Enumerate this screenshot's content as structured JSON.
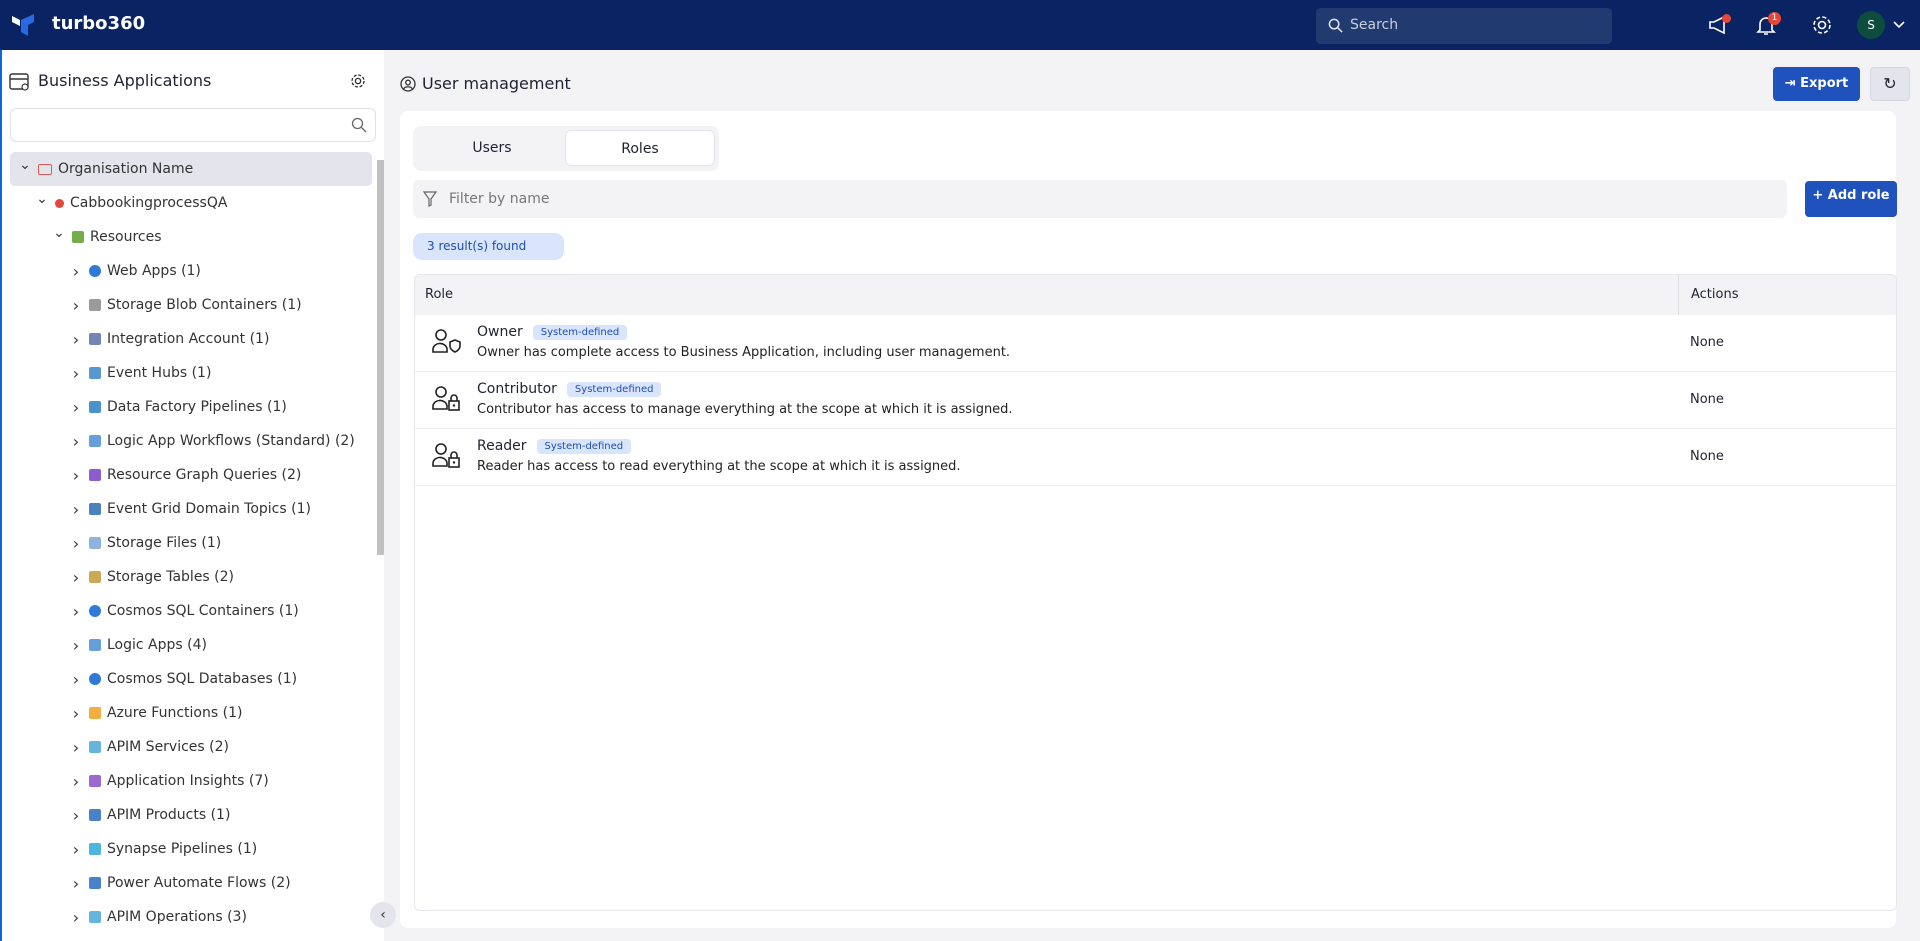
{
  "header": {
    "brand": "turbo360",
    "search_placeholder": "Search",
    "notification_count": "1",
    "avatar_initial": "S"
  },
  "sidebar": {
    "title": "Business Applications",
    "search_placeholder": "",
    "tree": [
      {
        "label": "Organisation Name",
        "level": 0,
        "icon": "folder-icon",
        "color": "#e05a5a",
        "selected": true,
        "expanded": true
      },
      {
        "label": "CabbookingprocessQA",
        "level": 1,
        "icon": "status-dot-icon",
        "color": "#e5463a",
        "expanded": true
      },
      {
        "label": "Resources",
        "level": 2,
        "icon": "grid-icon",
        "color": "#5aa02c",
        "expanded": true
      },
      {
        "label": "Web Apps (1)",
        "level": 3,
        "icon": "globe-icon",
        "color": "#2f7ad6"
      },
      {
        "label": "Storage Blob Containers (1)",
        "level": 3,
        "icon": "storage-icon",
        "color": "#8a8a8a"
      },
      {
        "label": "Integration Account (1)",
        "level": 3,
        "icon": "integration-icon",
        "color": "#5b6fa8"
      },
      {
        "label": "Event Hubs (1)",
        "level": 3,
        "icon": "event-hub-icon",
        "color": "#3a86c8"
      },
      {
        "label": "Data Factory Pipelines (1)",
        "level": 3,
        "icon": "data-factory-icon",
        "color": "#2a80c4"
      },
      {
        "label": "Logic App Workflows (Standard) (2)",
        "level": 3,
        "icon": "logic-app-icon",
        "color": "#4b8fd6"
      },
      {
        "label": "Resource Graph Queries (2)",
        "level": 3,
        "icon": "resource-graph-icon",
        "color": "#7b3fc4"
      },
      {
        "label": "Event Grid Domain Topics (1)",
        "level": 3,
        "icon": "event-grid-icon",
        "color": "#2b6cb0"
      },
      {
        "label": "Storage Files (1)",
        "level": 3,
        "icon": "file-icon",
        "color": "#7aa7d8"
      },
      {
        "label": "Storage Tables (2)",
        "level": 3,
        "icon": "table-icon",
        "color": "#c49a3a"
      },
      {
        "label": "Cosmos SQL Containers (1)",
        "level": 3,
        "icon": "cosmos-icon",
        "color": "#2f7ad6"
      },
      {
        "label": "Logic Apps (4)",
        "level": 3,
        "icon": "logic-app-icon",
        "color": "#4b8fd6"
      },
      {
        "label": "Cosmos SQL Databases (1)",
        "level": 3,
        "icon": "cosmos-icon",
        "color": "#2f7ad6"
      },
      {
        "label": "Azure Functions (1)",
        "level": 3,
        "icon": "function-icon",
        "color": "#f0a020"
      },
      {
        "label": "APIM Services (2)",
        "level": 3,
        "icon": "apim-icon",
        "color": "#4aa8d8"
      },
      {
        "label": "Application Insights (7)",
        "level": 3,
        "icon": "insights-icon",
        "color": "#8b4fc8"
      },
      {
        "label": "APIM Products (1)",
        "level": 3,
        "icon": "apim-product-icon",
        "color": "#2a6cc0"
      },
      {
        "label": "Synapse Pipelines (1)",
        "level": 3,
        "icon": "synapse-icon",
        "color": "#2fa8d8"
      },
      {
        "label": "Power Automate Flows (2)",
        "level": 3,
        "icon": "power-automate-icon",
        "color": "#2a6cc0"
      },
      {
        "label": "APIM Operations (3)",
        "level": 3,
        "icon": "apim-operation-icon",
        "color": "#4aa8d8"
      }
    ]
  },
  "page": {
    "title": "User management",
    "export_label": "Export",
    "tabs": [
      "Users",
      "Roles"
    ],
    "active_tab": "Roles",
    "filter_placeholder": "Filter by name",
    "add_role_label": "+ Add role",
    "result_count": "3 result(s) found",
    "table": {
      "columns": [
        "Role",
        "Actions"
      ],
      "rows": [
        {
          "name": "Owner",
          "badge": "System-defined",
          "description": "Owner has complete access to Business Application, including user management.",
          "actions": "None",
          "icon": "user-shield-icon"
        },
        {
          "name": "Contributor",
          "badge": "System-defined",
          "description": "Contributor has access to manage everything at the scope at which it is assigned.",
          "actions": "None",
          "icon": "user-lock-icon"
        },
        {
          "name": "Reader",
          "badge": "System-defined",
          "description": "Reader has access to read everything at the scope at which it is assigned.",
          "actions": "None",
          "icon": "user-lock-icon"
        }
      ]
    }
  },
  "colors": {
    "header_bg": "#0a2463",
    "primary": "#1f52bd",
    "badge_bg": "#d9e5fc"
  }
}
